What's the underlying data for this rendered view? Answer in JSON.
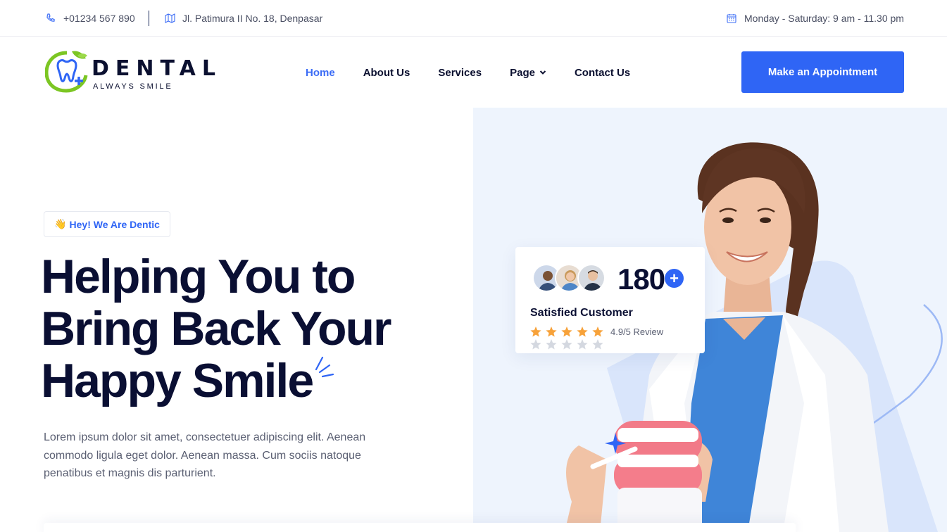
{
  "topbar": {
    "phone": "+01234 567 890",
    "address": "Jl. Patimura II No. 18, Denpasar",
    "hours": "Monday - Saturday: 9 am - 11.30 pm"
  },
  "logo": {
    "word": "DENTAL",
    "tagline": "ALWAYS SMILE"
  },
  "nav": {
    "items": [
      {
        "label": "Home",
        "active": true
      },
      {
        "label": "About Us"
      },
      {
        "label": "Services"
      },
      {
        "label": "Page",
        "dropdown": true
      },
      {
        "label": "Contact Us"
      }
    ],
    "cta": "Make an Appointment"
  },
  "hero": {
    "badge": "Hey! We Are Dentic",
    "title_lines": [
      "Helping You to",
      "Bring Back Your",
      "Happy Smile"
    ],
    "description": "Lorem ipsum dolor sit amet, consectetuer adipiscing elit. Aenean commodo ligula eget dolor. Aenean massa. Cum sociis natoque penatibus et magnis dis parturient."
  },
  "review_card": {
    "count": "180",
    "plus": "+",
    "label": "Satisfied Customer",
    "rating": 5,
    "review_text": "4.9/5 Review"
  },
  "colors": {
    "accent": "#2f65f5",
    "dark": "#0a0f33",
    "hero_bg": "#eef4fd",
    "star": "#f7a23a"
  }
}
